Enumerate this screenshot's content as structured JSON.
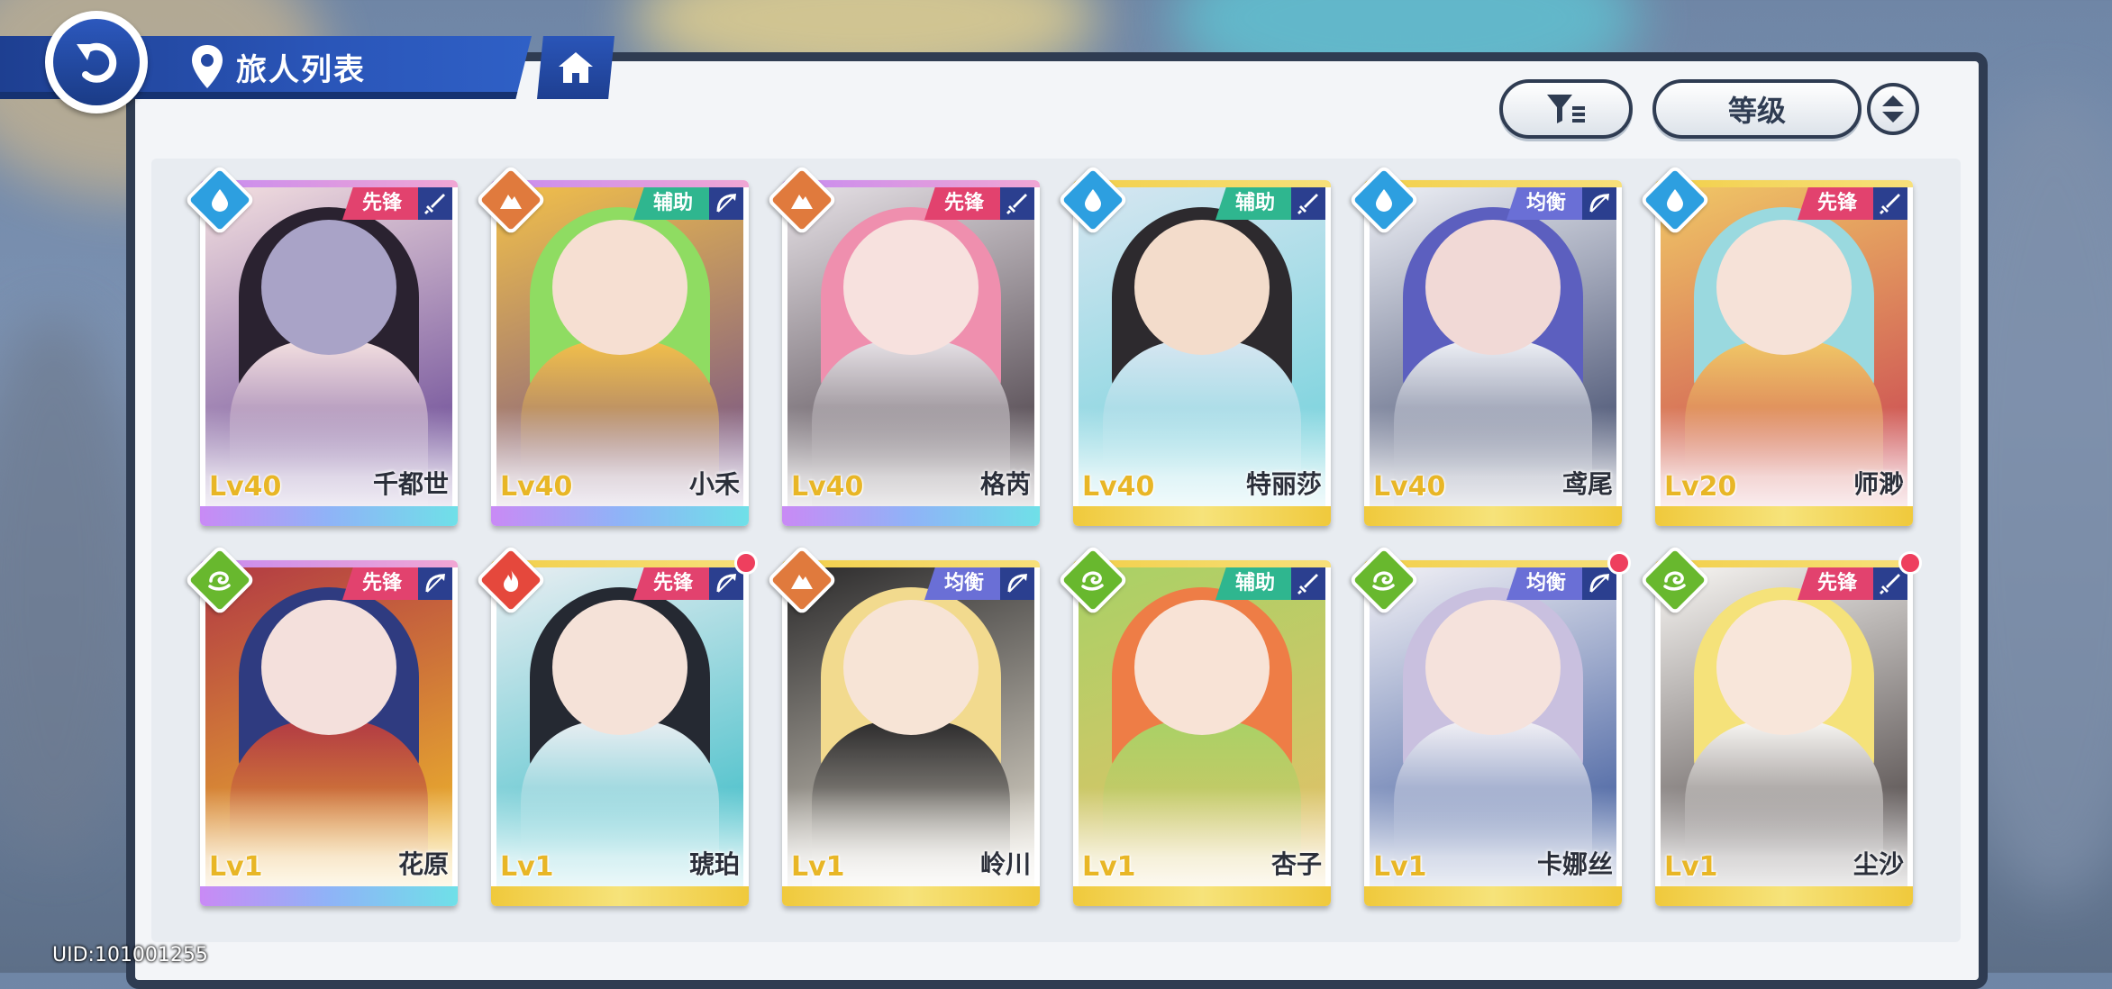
{
  "header": {
    "title": "旅人列表"
  },
  "controls": {
    "sort_label": "等级"
  },
  "footer": {
    "uid": "UID:101001255"
  },
  "colors": {
    "role_vanguard": "#e2426e",
    "role_support": "#2fb68f",
    "role_balance": "#6a6fd6",
    "elem_water": "#2d9fe0",
    "elem_earth": "#e07a3d",
    "elem_wind": "#68b82e",
    "elem_fire": "#e5483c"
  },
  "cards": [
    {
      "level": "Lv40",
      "name": "千都世",
      "role": "先锋",
      "element": "water",
      "weapon": "sword-icon",
      "new": false,
      "frame": "purple",
      "palette": [
        "#2a2230",
        "#a9a3c7",
        "#f3dfe0",
        "#5d3b8f"
      ]
    },
    {
      "level": "Lv40",
      "name": "小禾",
      "role": "辅助",
      "element": "earth",
      "weapon": "bow-icon",
      "new": false,
      "frame": "purple",
      "palette": [
        "#8fdc62",
        "#f6dfd2",
        "#f2c04a",
        "#6b4a8c"
      ]
    },
    {
      "level": "Lv40",
      "name": "格芮",
      "role": "先锋",
      "element": "earth",
      "weapon": "sword-icon",
      "new": false,
      "frame": "purple",
      "palette": [
        "#ef8fae",
        "#f7e1de",
        "#e6e1e6",
        "#3a2f37"
      ]
    },
    {
      "level": "Lv40",
      "name": "特丽莎",
      "role": "辅助",
      "element": "water",
      "weapon": "sword-icon",
      "new": false,
      "frame": "gold",
      "palette": [
        "#2d2a2e",
        "#f3dccb",
        "#d6e6f1",
        "#6bd0da"
      ]
    },
    {
      "level": "Lv40",
      "name": "鸢尾",
      "role": "均衡",
      "element": "water",
      "weapon": "bow-icon",
      "new": false,
      "frame": "gold",
      "palette": [
        "#5c5fbf",
        "#f1d9d6",
        "#eef0f6",
        "#2f3a5e"
      ]
    },
    {
      "level": "Lv20",
      "name": "师渺",
      "role": "先锋",
      "element": "water",
      "weapon": "sword-icon",
      "new": false,
      "frame": "gold",
      "palette": [
        "#9ad9df",
        "#f6e2d8",
        "#f0c766",
        "#c73c50"
      ]
    },
    {
      "level": "Lv1",
      "name": "花原",
      "role": "先锋",
      "element": "wind",
      "weapon": "bow-icon",
      "new": false,
      "frame": "purple",
      "palette": [
        "#2f3b80",
        "#f4e0dc",
        "#b23a44",
        "#f3c02a"
      ]
    },
    {
      "level": "Lv1",
      "name": "琥珀",
      "role": "先锋",
      "element": "fire",
      "weapon": "bow-icon",
      "new": true,
      "frame": "gold",
      "palette": [
        "#252932",
        "#f5e2d8",
        "#e9eef2",
        "#2fb9c4"
      ]
    },
    {
      "level": "Lv1",
      "name": "岭川",
      "role": "均衡",
      "element": "earth",
      "weapon": "bow-icon",
      "new": false,
      "frame": "gold",
      "palette": [
        "#f2da8e",
        "#f7e4d6",
        "#2b2a2b",
        "#e8e2d4"
      ]
    },
    {
      "level": "Lv1",
      "name": "杏子",
      "role": "辅助",
      "element": "wind",
      "weapon": "sword-icon",
      "new": false,
      "frame": "gold",
      "palette": [
        "#ee7d46",
        "#f8e3d6",
        "#a9d166",
        "#e7c068"
      ]
    },
    {
      "level": "Lv1",
      "name": "卡娜丝",
      "role": "均衡",
      "element": "wind",
      "weapon": "bow-icon",
      "new": true,
      "frame": "gold",
      "palette": [
        "#c9c0df",
        "#f5e2dc",
        "#f2f1f6",
        "#2c4b93"
      ]
    },
    {
      "level": "Lv1",
      "name": "尘沙",
      "role": "先锋",
      "element": "wind",
      "weapon": "sword-icon",
      "new": true,
      "frame": "gold",
      "palette": [
        "#f5e27a",
        "#f8e6da",
        "#f8f6f3",
        "#3a3232"
      ]
    }
  ]
}
